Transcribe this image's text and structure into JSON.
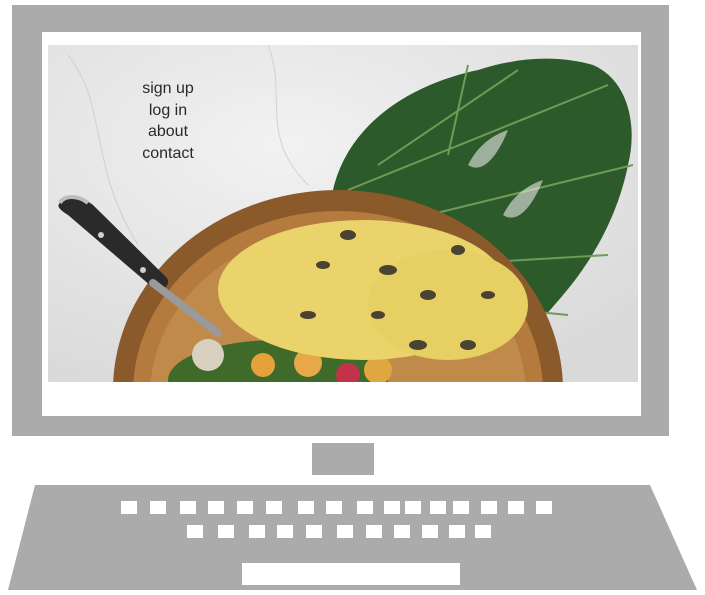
{
  "nav": {
    "items": [
      {
        "label": "sign up"
      },
      {
        "label": "log in"
      },
      {
        "label": "about"
      },
      {
        "label": "contact"
      }
    ]
  },
  "hero": {
    "image": "food-bowl-with-monstera-leaf",
    "leaf_color": "#2e5a2a",
    "bowl_color": "#b57a3d",
    "grain_color": "#e9d36a"
  },
  "device": {
    "frame_color": "#ababab",
    "screen_color": "#ffffff"
  }
}
